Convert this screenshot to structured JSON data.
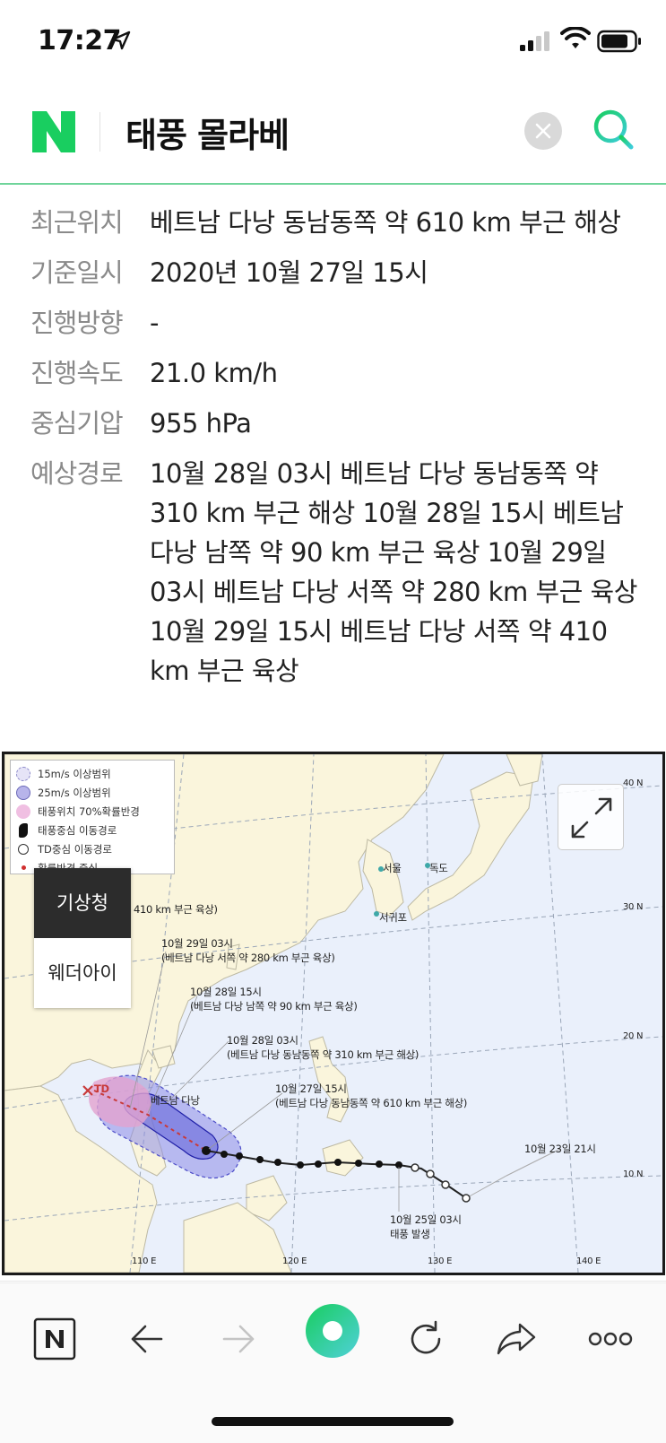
{
  "status": {
    "time": "17:27"
  },
  "header": {
    "query": "태풍 몰라베",
    "accent": "#19ce60"
  },
  "info": [
    {
      "key": "최근위치",
      "value": "베트남 다낭 동남동쪽 약 610 km 부근 해상"
    },
    {
      "key": "기준일시",
      "value": "2020년 10월 27일 15시"
    },
    {
      "key": "진행방향",
      "value": "-"
    },
    {
      "key": "진행속도",
      "value": "21.0 km/h"
    },
    {
      "key": "중심기압",
      "value": "955 hPa"
    },
    {
      "key": "예상경로",
      "value": "10월 28일 03시 베트남 다낭 동남동쪽 약 310 km 부근 해상 10월 28일 15시 베트남 다낭 남쪽 약 90 km 부근 육상 10월 29일 03시 베트남 다낭 서쪽 약 280 km 부근 육상 10월 29일 15시 베트남 다낭 서쪽 약 410 km 부근 육상"
    }
  ],
  "map": {
    "legend": [
      "15m/s 이상범위",
      "25m/s 이상범위",
      "태풍위치 70%확률반경",
      "태풍중심 이동경로",
      "TD중심 이동경로",
      "확률반경 중심"
    ],
    "source_tabs": {
      "active": "기상청",
      "inactive": "웨더아이"
    },
    "labels": {
      "l_410": "410 km 부근 육상)",
      "l_29_03_t": "10월 29일 03시",
      "l_29_03_d": "(베트남 다낭 서쪽 약 280 km 부근 육상)",
      "l_28_15_t": "10월 28일 15시",
      "l_28_15_d": "(베트남 다낭 남쪽 약 90 km 부근 육상)",
      "l_28_03_t": "10월 28일 03시",
      "l_28_03_d": "(베트남 다낭 동남동쪽 약 310 km 부근 해상)",
      "l_27_15_t": "10월 27일 15시",
      "l_27_15_d": "(베트남 다낭 동남동쪽 약 610 km 부근 해상)",
      "l_23_21": "10월 23일 21시",
      "l_25_03_t": "10월 25일 03시",
      "l_25_03_d": "태풍 발생",
      "danang": "베트남 다낭",
      "td": "TD",
      "seoul": "서울",
      "dokdo": "독도",
      "seogwipo": "서귀포",
      "lat40": "40 N",
      "lat30": "30 N",
      "lat20": "20 N",
      "lat10": "10 N",
      "lon110": "110 E",
      "lon120": "120 E",
      "lon130": "130 E",
      "lon140": "140 E"
    }
  }
}
